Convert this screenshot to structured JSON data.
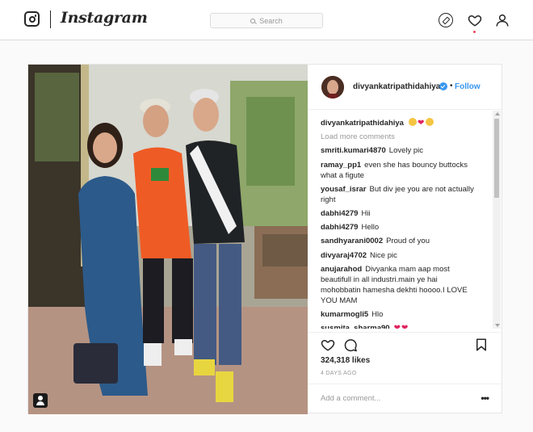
{
  "nav": {
    "logo_text": "Instagram",
    "search_placeholder": "Search",
    "icons": [
      "instagram-glyph-icon",
      "compass-icon",
      "heart-icon",
      "profile-icon"
    ]
  },
  "post": {
    "username": "divyankatripathidahiya",
    "follow_label": "Follow",
    "header_dot": "•",
    "caption_user": "divyankatripathidahiya",
    "load_more": "Load more comments",
    "comments": [
      {
        "user": "smriti.kumari4870",
        "text": "Lovely pic"
      },
      {
        "user": "ramay_pp1",
        "text": "even she has bouncy buttocks what a figute"
      },
      {
        "user": "yousaf_israr",
        "text": "But div jee you are not actually right"
      },
      {
        "user": "dabhi4279",
        "text": "Hii"
      },
      {
        "user": "dabhi4279",
        "text": "Hello"
      },
      {
        "user": "sandhyarani0002",
        "text": "Proud of you"
      },
      {
        "user": "divyaraj4702",
        "text": "Nice pic"
      },
      {
        "user": "anujarahod",
        "text": "Divyanka mam aap most beautifull in all industri.main ye hai mohobbatin hamesha dekhti hoooo.I LOVE YOU MAM"
      },
      {
        "user": "kumarmogli5",
        "text": "Hlo"
      },
      {
        "user": "susmita_sharma90",
        "text": ""
      }
    ],
    "likes": "324,318 likes",
    "time": "4 DAYS AGO",
    "add_comment_placeholder": "Add a comment...",
    "more_label": "•••"
  },
  "colors": {
    "accent": "#3897f0",
    "notification": "#ed4956",
    "border": "#dbdbdb"
  }
}
